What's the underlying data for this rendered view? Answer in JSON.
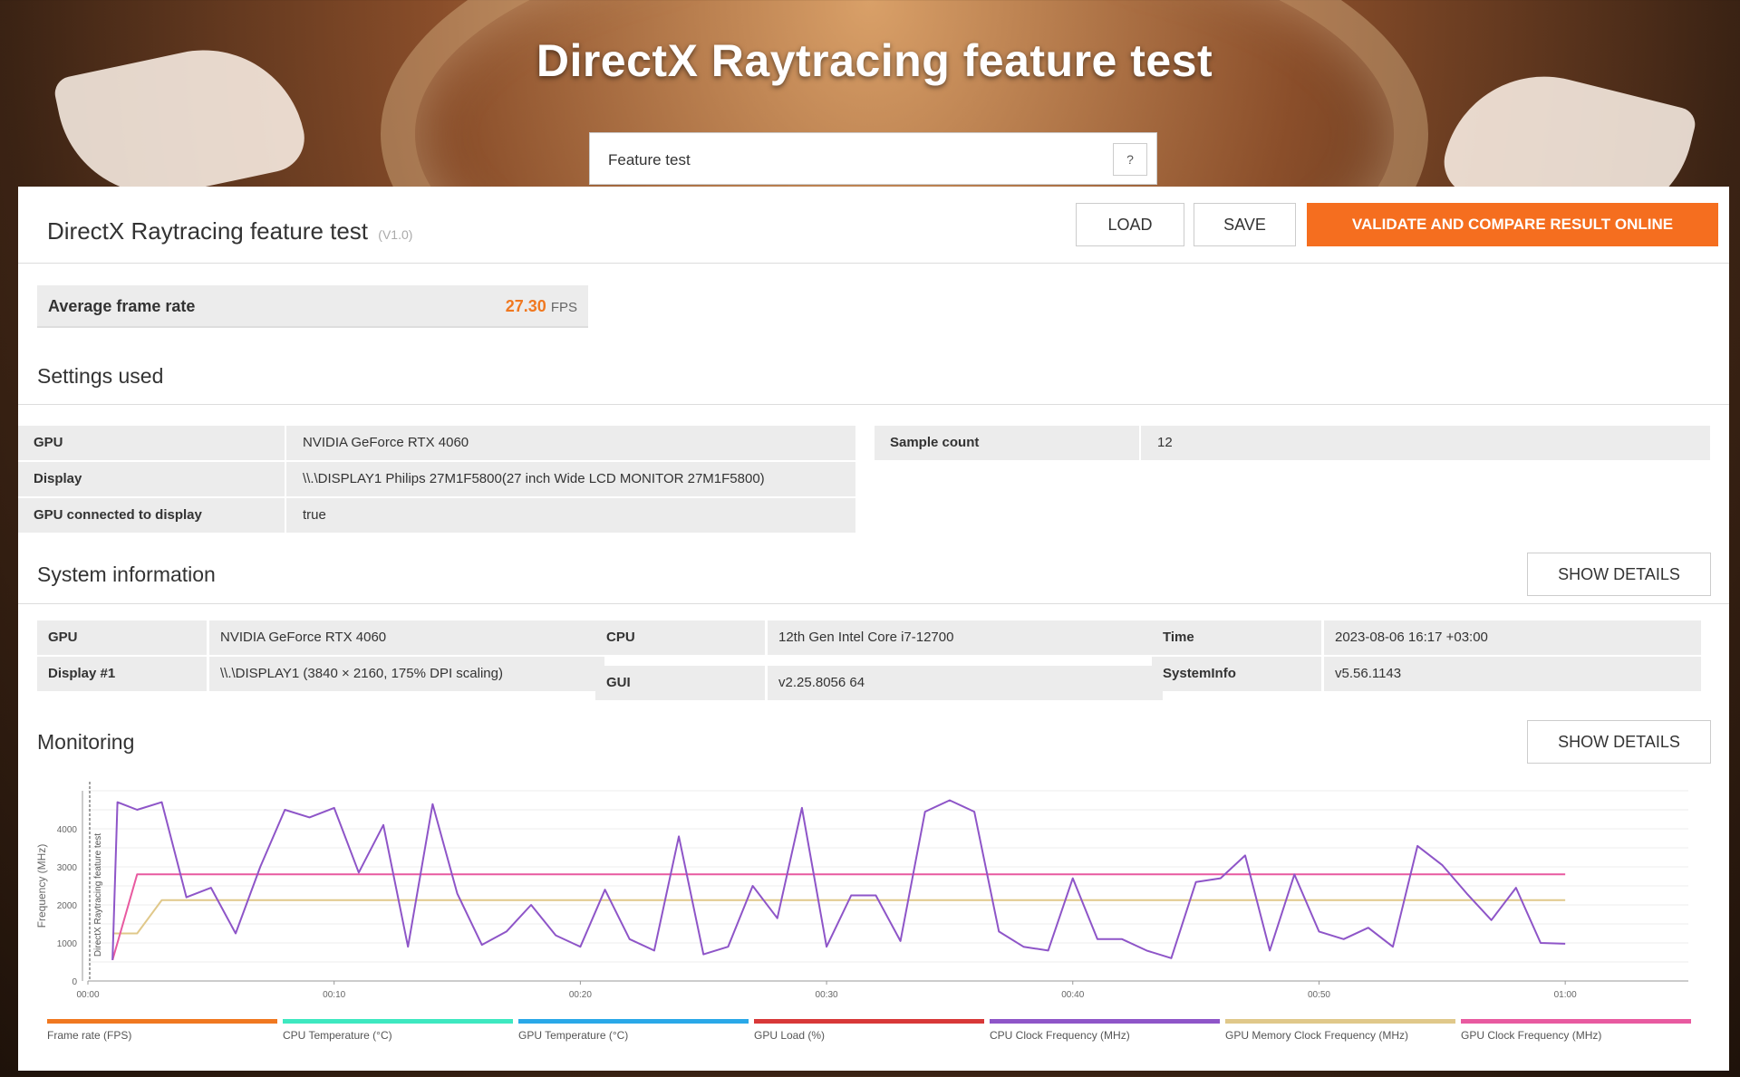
{
  "hero": {
    "title": "DirectX Raytracing feature test"
  },
  "mode": {
    "label": "Feature test",
    "help": "?"
  },
  "header": {
    "title": "DirectX Raytracing feature test",
    "version": "(V1.0)",
    "load": "LOAD",
    "save": "SAVE",
    "validate": "VALIDATE AND COMPARE RESULT ONLINE"
  },
  "score": {
    "label": "Average frame rate",
    "value": "27.30",
    "unit": "FPS"
  },
  "settings": {
    "title": "Settings used",
    "left": [
      {
        "k": "GPU",
        "v": "NVIDIA GeForce RTX 4060"
      },
      {
        "k": "Display",
        "v": "\\\\.\\DISPLAY1 Philips 27M1F5800(27 inch Wide LCD MONITOR 27M1F5800)"
      },
      {
        "k": "GPU connected to display",
        "v": "true"
      }
    ],
    "right": [
      {
        "k": "Sample count",
        "v": "12"
      }
    ]
  },
  "sysinfo": {
    "title": "System information",
    "show": "SHOW DETAILS",
    "col1": [
      {
        "k": "GPU",
        "v": "NVIDIA GeForce RTX 4060"
      },
      {
        "k": "Display #1",
        "v": "\\\\.\\DISPLAY1 (3840 × 2160, 175% DPI scaling)"
      }
    ],
    "col2": [
      {
        "k": "CPU",
        "v": "12th Gen Intel Core i7-12700"
      },
      {
        "k": "GUI",
        "v": "v2.25.8056 64"
      }
    ],
    "col3": [
      {
        "k": "Time",
        "v": "2023-08-06 16:17 +03:00"
      },
      {
        "k": "SystemInfo",
        "v": "v5.56.1143"
      }
    ]
  },
  "monitoring": {
    "title": "Monitoring",
    "show": "SHOW DETAILS"
  },
  "chart_data": {
    "type": "line",
    "ylabel": "Frequency (MHz)",
    "annotation": "DirectX Raytracing feature test",
    "ylim": [
      0,
      5000
    ],
    "xlim": [
      0,
      65
    ],
    "y_ticks": [
      0,
      1000,
      2000,
      3000,
      4000
    ],
    "x_ticks": [
      "00:00",
      "00:10",
      "00:20",
      "00:30",
      "00:40",
      "00:50",
      "01:00"
    ],
    "x_tick_values": [
      0,
      10,
      20,
      30,
      40,
      50,
      60
    ],
    "grid": true,
    "legend_position": "bottom",
    "legend": [
      {
        "name": "Frame rate (FPS)",
        "color": "#f07820"
      },
      {
        "name": "CPU Temperature (°C)",
        "color": "#3ee8c0"
      },
      {
        "name": "GPU Temperature (°C)",
        "color": "#2aa8e8"
      },
      {
        "name": "GPU Load (%)",
        "color": "#d83838"
      },
      {
        "name": "CPU Clock Frequency (MHz)",
        "color": "#8e55c8"
      },
      {
        "name": "GPU Memory Clock Frequency (MHz)",
        "color": "#e0c88a"
      },
      {
        "name": "GPU Clock Frequency (MHz)",
        "color": "#e85aa0"
      }
    ],
    "series": [
      {
        "name": "CPU Clock Frequency (MHz)",
        "color": "#8e55c8",
        "x": [
          1,
          1.2,
          2,
          3,
          4,
          5,
          6,
          7,
          8,
          9,
          10,
          11,
          12,
          13,
          14,
          15,
          16,
          17,
          18,
          19,
          20,
          21,
          22,
          23,
          24,
          25,
          26,
          27,
          28,
          29,
          30,
          31,
          32,
          33,
          34,
          35,
          36,
          37,
          38,
          39,
          40,
          41,
          42,
          43,
          44,
          45,
          46,
          47,
          48,
          49,
          50,
          51,
          52,
          53,
          54,
          55,
          56,
          57,
          58,
          59,
          60
        ],
        "y": [
          550,
          4700,
          4500,
          4700,
          2200,
          2450,
          1250,
          3000,
          4500,
          4300,
          4550,
          2850,
          4100,
          900,
          4650,
          2300,
          950,
          1300,
          2000,
          1200,
          900,
          2400,
          1100,
          800,
          3800,
          700,
          900,
          2500,
          1650,
          4550,
          900,
          2250,
          2250,
          1050,
          4450,
          4750,
          4450,
          1300,
          900,
          800,
          2700,
          1100,
          1100,
          800,
          600,
          2600,
          2700,
          3300,
          800,
          2800,
          1300,
          1100,
          1400,
          900,
          3550,
          3050,
          2300,
          1600,
          2450,
          1000,
          980
        ]
      },
      {
        "name": "GPU Clock Frequency (MHz)",
        "color": "#e85aa0",
        "x": [
          1,
          2,
          60
        ],
        "y": [
          550,
          2805,
          2805
        ]
      },
      {
        "name": "GPU Memory Clock Frequency (MHz)",
        "color": "#e0c88a",
        "x": [
          1,
          2,
          3,
          60
        ],
        "y": [
          1250,
          1250,
          2125,
          2125
        ]
      }
    ]
  }
}
